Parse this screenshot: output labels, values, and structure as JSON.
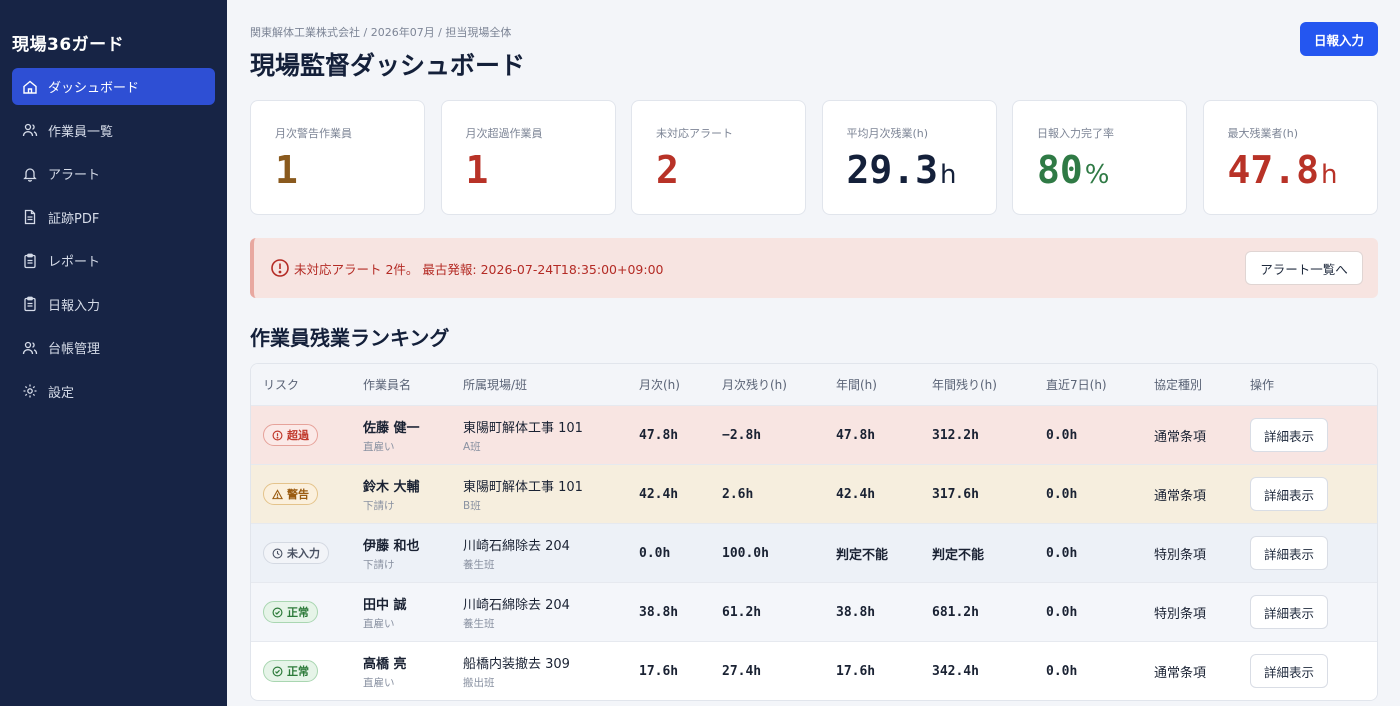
{
  "sidebar": {
    "brand": "現場36ガード",
    "items": [
      {
        "label": "ダッシュボード",
        "icon": "home-icon",
        "active": true
      },
      {
        "label": "作業員一覧",
        "icon": "users-icon"
      },
      {
        "label": "アラート",
        "icon": "bell-icon"
      },
      {
        "label": "証跡PDF",
        "icon": "document-icon"
      },
      {
        "label": "レポート",
        "icon": "clipboard-icon"
      },
      {
        "label": "日報入力",
        "icon": "clipboard-icon"
      },
      {
        "label": "台帳管理",
        "icon": "users-icon"
      },
      {
        "label": "設定",
        "icon": "gear-icon"
      }
    ]
  },
  "header": {
    "breadcrumb": "関東解体工業株式会社 / 2026年07月 / 担当現場全体",
    "title": "現場監督ダッシュボード",
    "action_label": "日報入力"
  },
  "summary": [
    {
      "label": "月次警告作業員",
      "value": "1",
      "unit": "",
      "color": "#8a5a1e"
    },
    {
      "label": "月次超過作業員",
      "value": "1",
      "unit": "",
      "color": "#b83227"
    },
    {
      "label": "未対応アラート",
      "value": "2",
      "unit": "",
      "color": "#b83227"
    },
    {
      "label": "平均月次残業(h)",
      "value": "29.3",
      "unit": "h",
      "color": "#14203a"
    },
    {
      "label": "日報入力完了率",
      "value": "80",
      "unit": "%",
      "color": "#2f7a45"
    },
    {
      "label": "最大残業者(h)",
      "value": "47.8",
      "unit": "h",
      "color": "#b83227"
    }
  ],
  "alert": {
    "text": "未対応アラート 2件。 最古発報: 2026-07-24T18:35:00+09:00",
    "button_label": "アラート一覧へ"
  },
  "ranking": {
    "title": "作業員残業ランキング",
    "columns": [
      "リスク",
      "作業員名",
      "所属現場/班",
      "月次(h)",
      "月次残り(h)",
      "年間(h)",
      "年間残り(h)",
      "直近7日(h)",
      "協定種別",
      "操作"
    ],
    "rows": [
      {
        "risk": "超過",
        "risk_type": "over",
        "name": "佐藤 健一",
        "employment": "直雇い",
        "site": "東陽町解体工事 101",
        "team": "A班",
        "monthly": "47.8h",
        "monthly_remaining": "−2.8h",
        "annual": "47.8h",
        "annual_remaining": "312.2h",
        "last7": "0.0h",
        "agreement": "通常条項",
        "action": "詳細表示"
      },
      {
        "risk": "警告",
        "risk_type": "warn",
        "name": "鈴木 大輔",
        "employment": "下請け",
        "site": "東陽町解体工事 101",
        "team": "B班",
        "monthly": "42.4h",
        "monthly_remaining": "2.6h",
        "annual": "42.4h",
        "annual_remaining": "317.6h",
        "last7": "0.0h",
        "agreement": "通常条項",
        "action": "詳細表示"
      },
      {
        "risk": "未入力",
        "risk_type": "noinput",
        "name": "伊藤 和也",
        "employment": "下請け",
        "site": "川崎石綿除去 204",
        "team": "養生班",
        "monthly": "0.0h",
        "monthly_remaining": "100.0h",
        "annual": "判定不能",
        "annual_remaining": "判定不能",
        "last7": "0.0h",
        "agreement": "特別条項",
        "action": "詳細表示"
      },
      {
        "risk": "正常",
        "risk_type": "normal",
        "name": "田中 誠",
        "employment": "直雇い",
        "site": "川崎石綿除去 204",
        "team": "養生班",
        "monthly": "38.8h",
        "monthly_remaining": "61.2h",
        "annual": "38.8h",
        "annual_remaining": "681.2h",
        "last7": "0.0h",
        "agreement": "特別条項",
        "action": "詳細表示"
      },
      {
        "risk": "正常",
        "risk_type": "normal",
        "name": "高橋 亮",
        "employment": "直雇い",
        "site": "船橋内装撤去 309",
        "team": "搬出班",
        "monthly": "17.6h",
        "monthly_remaining": "27.4h",
        "annual": "17.6h",
        "annual_remaining": "342.4h",
        "last7": "0.0h",
        "agreement": "通常条項",
        "action": "詳細表示"
      }
    ]
  }
}
